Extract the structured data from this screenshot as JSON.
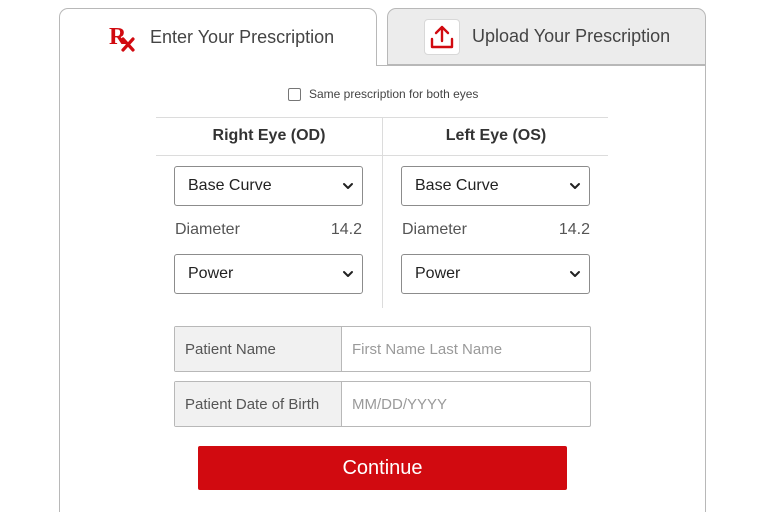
{
  "tabs": [
    {
      "label": "Enter Your Prescription",
      "icon": "rx-icon",
      "active": true
    },
    {
      "label": "Upload Your Prescription",
      "icon": "upload-icon",
      "active": false
    }
  ],
  "same_prescription_label": "Same prescription for both eyes",
  "right_eye": {
    "heading": "Right Eye (OD)",
    "base_curve": "Base Curve",
    "diameter_label": "Diameter",
    "diameter_value": "14.2",
    "power": "Power"
  },
  "left_eye": {
    "heading": "Left Eye (OS)",
    "base_curve": "Base Curve",
    "diameter_label": "Diameter",
    "diameter_value": "14.2",
    "power": "Power"
  },
  "patient_name": {
    "label": "Patient Name",
    "placeholder": "First Name Last Name"
  },
  "patient_dob": {
    "label": "Patient Date of Birth",
    "placeholder": "MM/DD/YYYY"
  },
  "continue_label": "Continue",
  "colors": {
    "accent": "#d10a10",
    "tab_inactive": "#ececec",
    "label_bg": "#f1f1f1"
  }
}
